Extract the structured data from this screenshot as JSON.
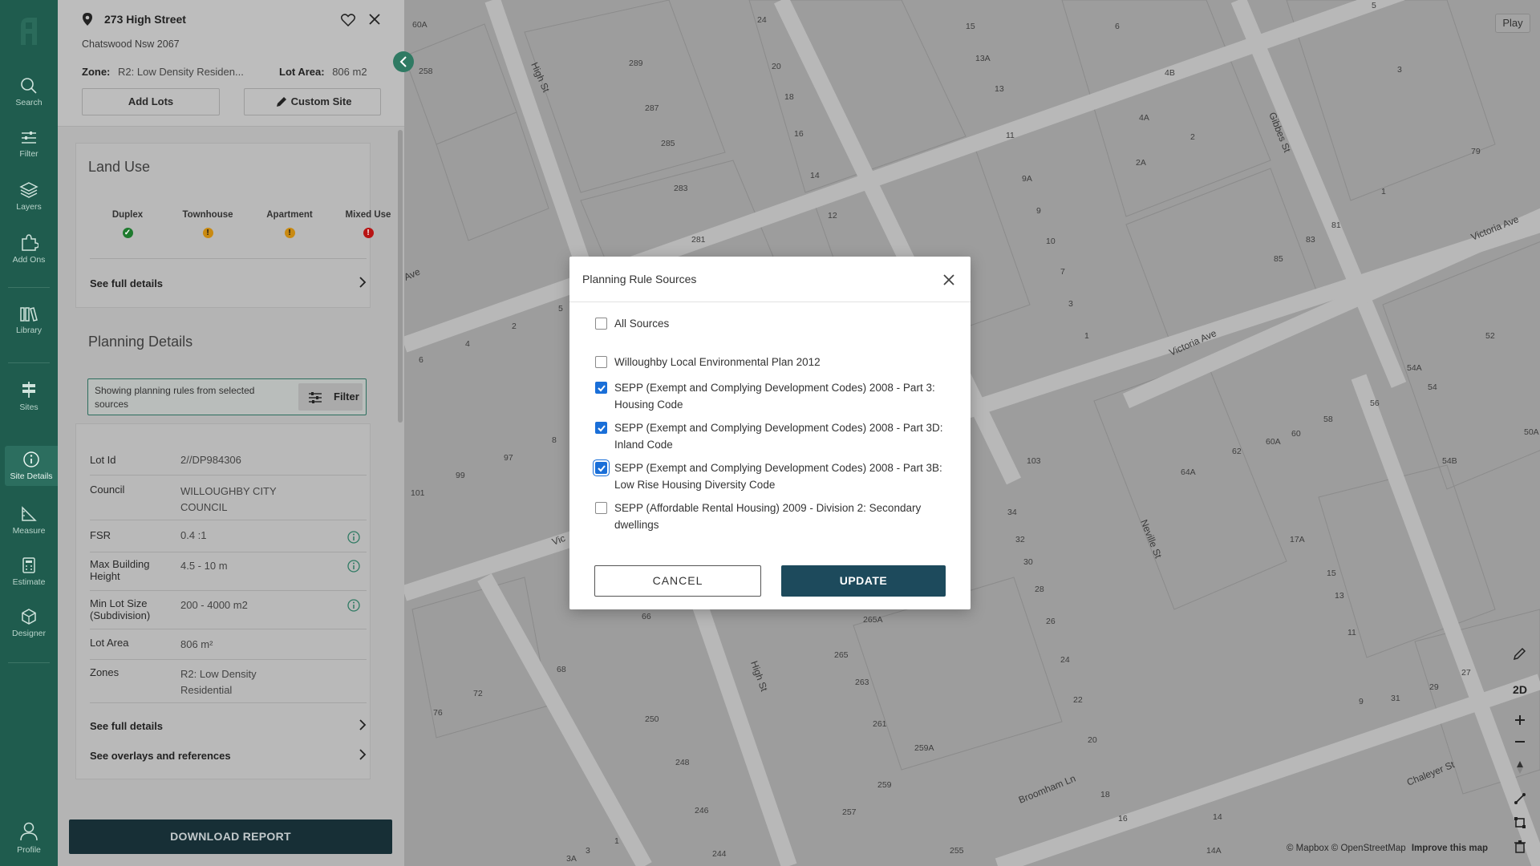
{
  "nav": {
    "items": [
      {
        "label": "Search",
        "icon": "search-icon"
      },
      {
        "label": "Filter",
        "icon": "filter-icon"
      },
      {
        "label": "Layers",
        "icon": "layers-icon"
      },
      {
        "label": "Add Ons",
        "icon": "puzzle-icon"
      },
      {
        "label": "Library",
        "icon": "library-icon"
      },
      {
        "label": "Sites",
        "icon": "sites-icon"
      },
      {
        "label": "Site Details",
        "icon": "info-icon"
      },
      {
        "label": "Measure",
        "icon": "measure-icon"
      },
      {
        "label": "Estimate",
        "icon": "calculator-icon"
      },
      {
        "label": "Designer",
        "icon": "cube-icon"
      },
      {
        "label": "Profile",
        "icon": "user-icon"
      }
    ],
    "active": "Site Details"
  },
  "site": {
    "address": "273 High Street",
    "suburb": "Chatswood Nsw 2067",
    "zone_label": "Zone:",
    "zone_value": "R2: Low Density Residen...",
    "lot_area_label": "Lot Area:",
    "lot_area_value": "806 m2",
    "add_lots": "Add Lots",
    "custom_site": "Custom Site"
  },
  "land_use": {
    "title": "Land Use",
    "columns": [
      {
        "label": "Duplex",
        "status": "permitted",
        "color": "#1e7a2e",
        "symbol": "✓"
      },
      {
        "label": "Townhouse",
        "status": "conditional",
        "color": "#c98a12",
        "symbol": "!"
      },
      {
        "label": "Apartment",
        "status": "conditional",
        "color": "#c98a12",
        "symbol": "!"
      },
      {
        "label": "Mixed Use",
        "status": "prohibited",
        "color": "#b81414",
        "symbol": "!"
      }
    ],
    "see_full_details": "See full details"
  },
  "planning": {
    "title": "Planning Details",
    "filter_text": "Showing planning rules from selected sources",
    "filter_button": "Filter",
    "rows": [
      {
        "key": "Lot Id",
        "value": "2//DP984306",
        "info": false
      },
      {
        "key": "Council",
        "value": "WILLOUGHBY CITY COUNCIL",
        "info": false
      },
      {
        "key": "FSR",
        "value": "0.4 :1",
        "info": true
      },
      {
        "key": "Max Building Height",
        "value": "4.5 - 10 m",
        "info": true
      },
      {
        "key": "Min Lot Size (Subdivision)",
        "value": "200 - 4000 m2",
        "info": true
      },
      {
        "key": "Lot Area",
        "value": "806 m²",
        "info": false
      },
      {
        "key": "Zones",
        "value": "R2: Low Density Residential",
        "info": false
      }
    ],
    "see_full_details": "See full details",
    "see_overlays": "See overlays and references"
  },
  "download_report": "DOWNLOAD REPORT",
  "map": {
    "play": "Play",
    "mode_2d": "2D",
    "attribution": "© Mapbox © OpenStreetMap",
    "improve": "Improve this map",
    "streets": [
      "High St",
      "High St",
      "Victoria Ave",
      "Victoria Ave",
      "Gibbes St",
      "Neville St",
      "Broomham Ln",
      "Chaleyer St",
      "Ave",
      "Vic"
    ],
    "lot_numbers": [
      "60A",
      "258",
      "24",
      "15",
      "6",
      "5",
      "3",
      "289",
      "20",
      "13A",
      "4B",
      "18",
      "287",
      "4A",
      "285",
      "16",
      "13",
      "11",
      "2",
      "79",
      "14",
      "283",
      "9A",
      "12",
      "2A",
      "1",
      "281",
      "9",
      "81",
      "83",
      "85",
      "10",
      "7",
      "3",
      "1",
      "5",
      "2",
      "4",
      "6",
      "8",
      "97",
      "99",
      "101",
      "103",
      "34",
      "32",
      "30",
      "28",
      "26",
      "24",
      "22",
      "20",
      "18",
      "16",
      "14",
      "14A",
      "66",
      "68",
      "72",
      "76",
      "250",
      "248",
      "246",
      "244",
      "265A",
      "265",
      "263",
      "261",
      "259A",
      "259",
      "257",
      "255",
      "1",
      "3",
      "3A",
      "17A",
      "15",
      "13",
      "11",
      "9",
      "31",
      "29",
      "27",
      "62",
      "64A",
      "60A",
      "60",
      "58",
      "56",
      "54A",
      "54",
      "54B",
      "52",
      "50A"
    ]
  },
  "modal": {
    "title": "Planning Rule Sources",
    "options": [
      {
        "label": "All Sources",
        "checked": false
      },
      {
        "label": "Willoughby Local Environmental Plan 2012",
        "checked": false
      },
      {
        "label": "SEPP (Exempt and Complying Development Codes) 2008 - Part 3: Housing Code",
        "checked": true
      },
      {
        "label": "SEPP (Exempt and Complying Development Codes) 2008 - Part 3D: Inland Code",
        "checked": true
      },
      {
        "label": "SEPP (Exempt and Complying Development Codes) 2008 - Part 3B: Low Rise Housing Diversity Code",
        "checked": true
      },
      {
        "label": "SEPP (Affordable Rental Housing) 2009 - Division 2: Secondary dwellings",
        "checked": false
      }
    ],
    "cancel": "CANCEL",
    "update": "UPDATE"
  },
  "colors": {
    "nav_bg": "#1f5c4e",
    "primary_dark": "#1d4a5c",
    "checkbox_blue": "#1a6fd8",
    "accent_green": "#2f7a63"
  }
}
